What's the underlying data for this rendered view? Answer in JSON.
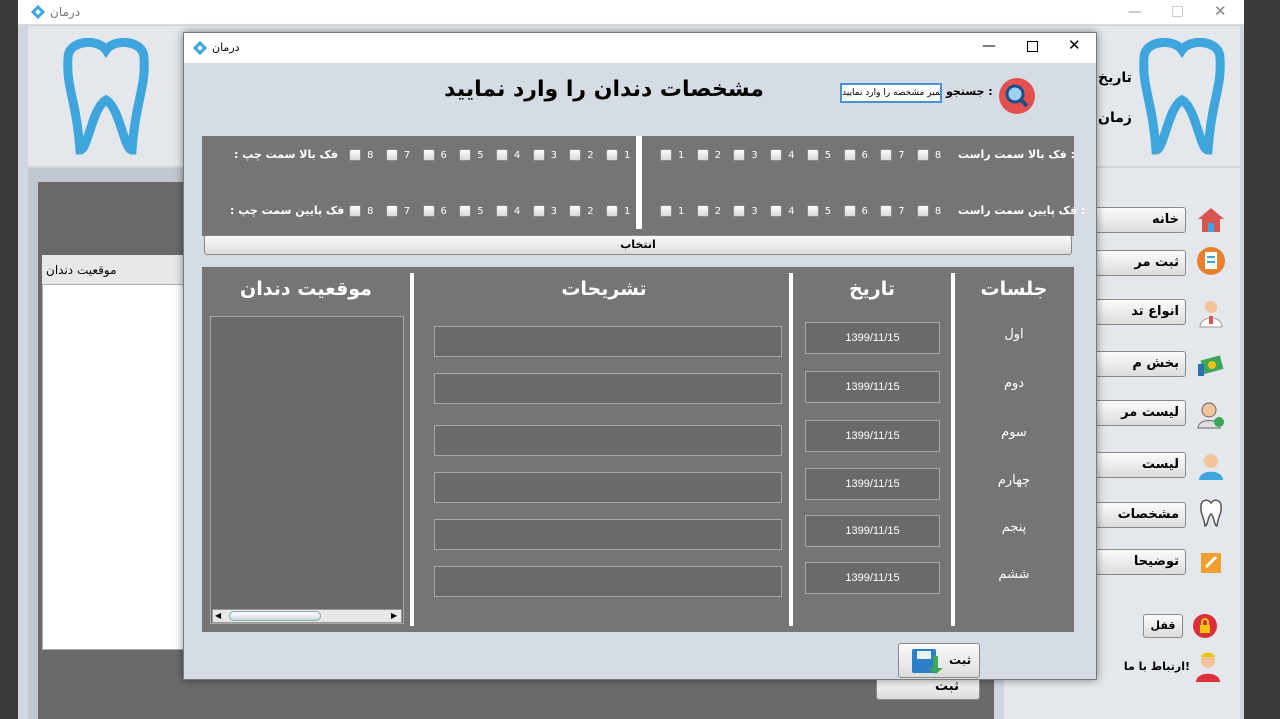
{
  "background_window": {
    "title": "درمان",
    "header_labels": [
      "تاریخ",
      "زمان"
    ],
    "left_panel_header": "موقعیت دندان",
    "sidebar": [
      {
        "label": "خانه",
        "icon": "home-icon"
      },
      {
        "label": "ثبت مر",
        "icon": "register-icon"
      },
      {
        "label": "انواع تد",
        "icon": "doctor-icon"
      },
      {
        "label": "بخش م",
        "icon": "payment-icon"
      },
      {
        "label": "لیست مر",
        "icon": "patient-list-icon"
      },
      {
        "label": "لیست",
        "icon": "user-list-icon"
      },
      {
        "label": "مشخصات",
        "icon": "tooth-icon"
      },
      {
        "label": "توضیحا",
        "icon": "edit-icon"
      }
    ],
    "lock_label": "قفل",
    "contact_label": "ارتباط با ما!",
    "bottom_button": "ثبت"
  },
  "dialog": {
    "title": "درمان",
    "heading": "مشخصات دندان را وارد نمایید",
    "search": {
      "label": "جستجو :",
      "placeholder": "نمبر مشخصه را وارد نمایید"
    },
    "jaws": {
      "upper_right": "فک بالا سمت راست :",
      "upper_left": ": فک بالا سمت چپ",
      "lower_right": "فک پایین سمت راست :",
      "lower_left": ": فک پایین سمت چپ",
      "numbers": [
        "1",
        "2",
        "3",
        "4",
        "5",
        "6",
        "7",
        "8"
      ]
    },
    "select_button": "انتخاب",
    "columns": {
      "sessions": "جلسات",
      "date": "تاریخ",
      "description": "تشریحات",
      "tooth_position": "موقعیت دندان"
    },
    "sessions": [
      "اول",
      "دوم",
      "سوم",
      "چهارم",
      "پنجم",
      "ششم"
    ],
    "dates": [
      "1399/11/15",
      "1399/11/15",
      "1399/11/15",
      "1399/11/15",
      "1399/11/15",
      "1399/11/15"
    ],
    "save_button": "ثبت"
  },
  "colors": {
    "accent_blue": "#3ea6dd",
    "panel_dark": "#757575",
    "search_red": "#e25050"
  }
}
